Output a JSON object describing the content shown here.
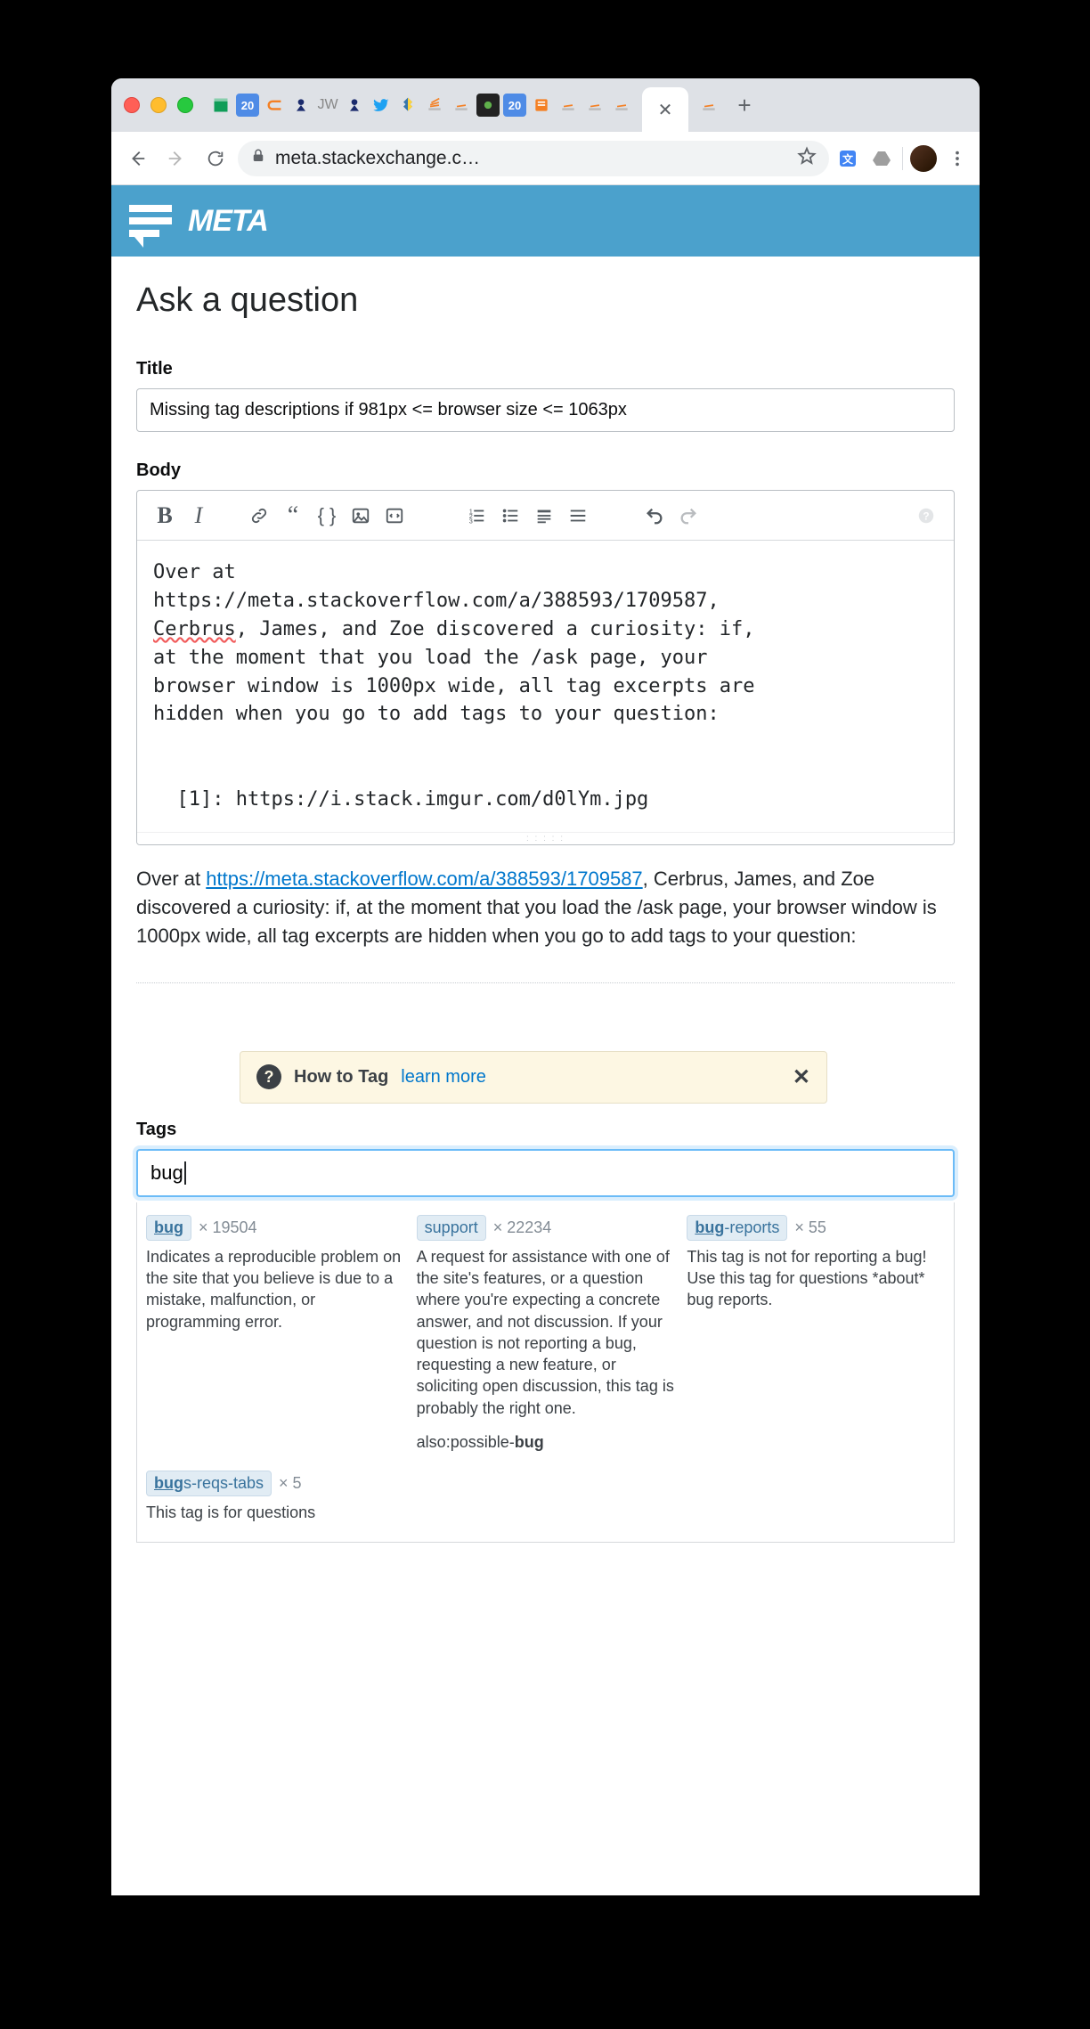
{
  "browser": {
    "url": "meta.stackexchange.c…",
    "new_tab_plus": "+"
  },
  "banner": {
    "site_name": "META"
  },
  "page": {
    "heading": "Ask a question",
    "title_label": "Title",
    "title_value": "Missing tag descriptions if 981px <= browser size <= 1063px",
    "body_label": "Body",
    "body_text_pre": "Over at\nhttps://meta.stackoverflow.com/a/388593/1709587,\n",
    "body_text_squiggle": "Cerbrus",
    "body_text_post": ", James, and Zoe discovered a curiosity: if,\nat the moment that you load the /ask page, your\nbrowser window is 1000px wide, all tag excerpts are\nhidden when you go to add tags to your question:\n\n\n  [1]: https://i.stack.imgur.com/d0lYm.jpg",
    "preview_pre": "Over at ",
    "preview_link": "https://meta.stackoverflow.com/a/388593/1709587",
    "preview_post": ", Cerbrus, James, and Zoe discovered a curiosity: if, at the moment that you load the /ask page, your browser window is 1000px wide, all tag excerpts are hidden when you go to add tags to your question:",
    "howto": {
      "title": "How to Tag",
      "link": "learn more",
      "close": "✕"
    },
    "tags_label": "Tags",
    "tag_input": "bug"
  },
  "suggestions": {
    "row1": [
      {
        "tag_html": "<b>bug</b>",
        "count": "× 19504",
        "desc": "Indicates a reproducible problem on the site that you believe is due to a mistake, malfunction, or programming error."
      },
      {
        "tag_html": "support",
        "count": "× 22234",
        "desc": "A request for assistance with one of the site's features, or a question where you're expecting a concrete answer, and not discussion. If your question is not reporting a bug, requesting a new feature, or soliciting open discussion, this tag is probably the right one.",
        "also": "also:possible-<b>bug</b>"
      },
      {
        "tag_html": "<b>bug</b>-reports",
        "count": "× 55",
        "desc": "This tag is not for reporting a bug! Use this tag for questions *about* bug reports."
      }
    ],
    "row2": [
      {
        "tag_html": "<b>bug</b>s-reqs-tabs",
        "count": "× 5",
        "desc": "This tag is for questions"
      }
    ]
  }
}
